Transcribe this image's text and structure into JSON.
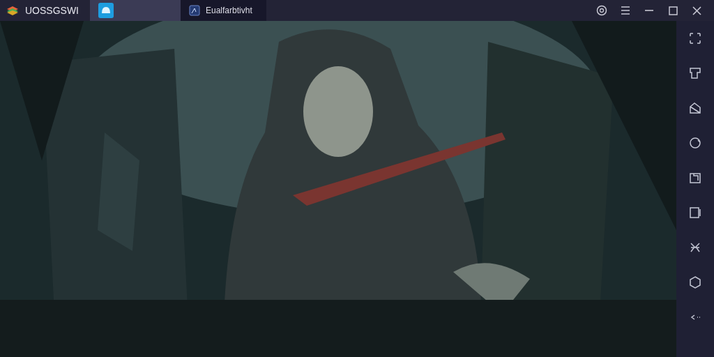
{
  "window": {
    "title": "UOSSGSWI"
  },
  "tabs": [
    {
      "kind": "icon",
      "selected": true
    },
    {
      "kind": "labeled",
      "label": "Eualfarbtivht",
      "selected": false
    }
  ]
}
